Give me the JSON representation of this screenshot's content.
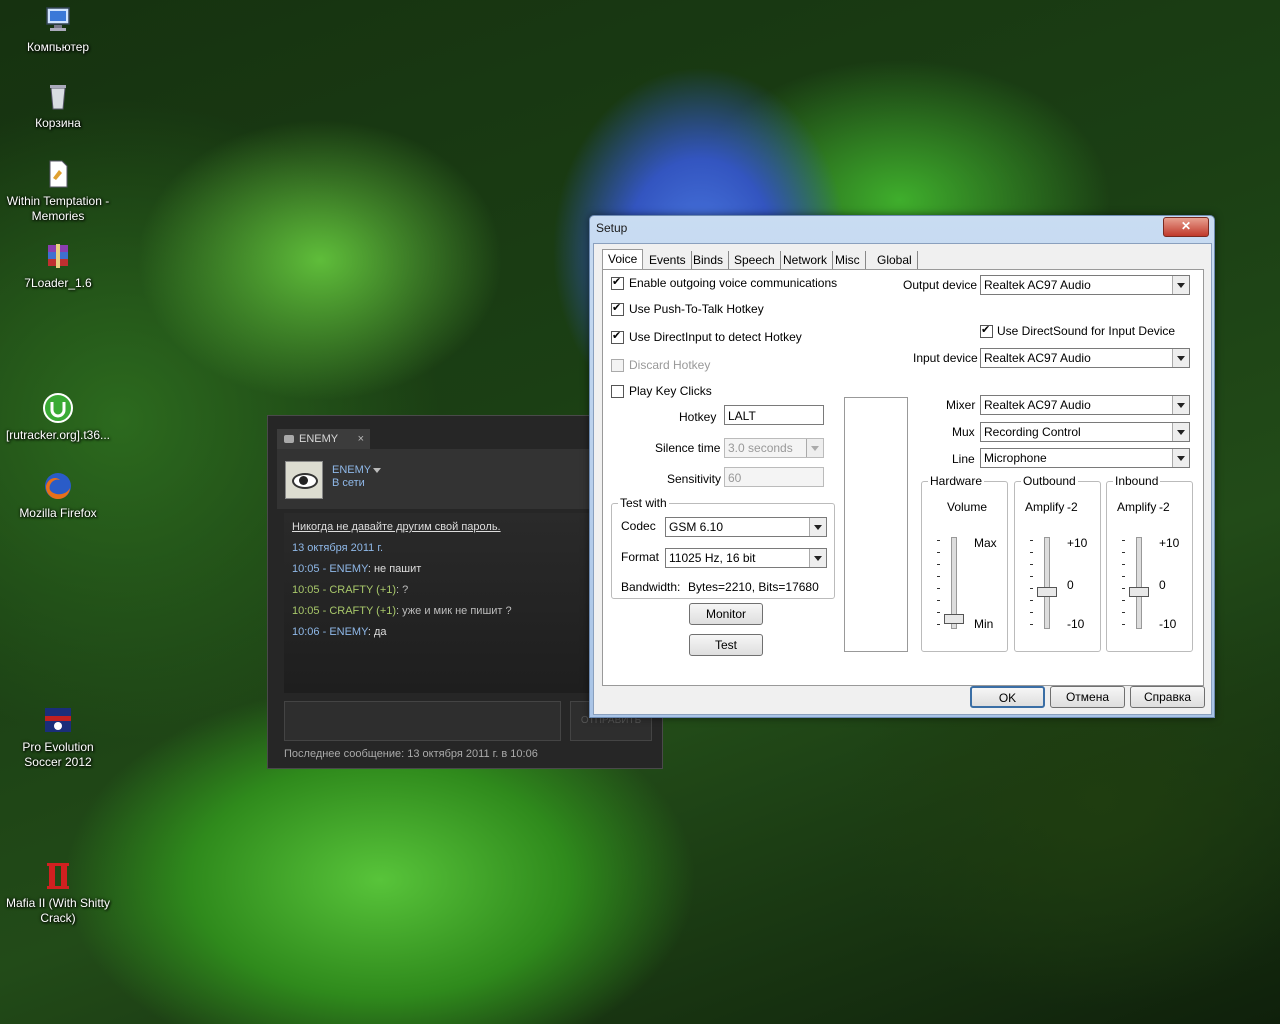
{
  "desktop": {
    "icons": [
      {
        "label": "Компьютер",
        "icon": "computer-icon"
      },
      {
        "label": "Корзина",
        "icon": "recycle-bin-icon"
      },
      {
        "label": "Within Temptation - Memories",
        "icon": "document-icon"
      },
      {
        "label": "7Loader_1.6",
        "icon": "archive-icon"
      },
      {
        "label": "[rutracker.org].t36...",
        "icon": "utorrent-icon"
      },
      {
        "label": "Mozilla Firefox",
        "icon": "firefox-icon"
      },
      {
        "label": "Pro Evolution Soccer 2012",
        "icon": "pes-icon"
      },
      {
        "label": "Mafia II (With Shitty Crack)",
        "icon": "mafia-icon"
      }
    ]
  },
  "chat": {
    "tab_label": "ENEMY",
    "tab_close": "×",
    "username": "ENEMY",
    "status": "В сети",
    "messages": {
      "warning": "Никогда не давайте другим свой пароль.",
      "date": "13 октября 2011 г.",
      "m1_time": "10:05 - ",
      "m1_user": "ENEMY",
      "m1_text": ": не пашит",
      "m2_time": "10:05 - ",
      "m2_user": "CRAFTY (+1)",
      "m2_text": ": ?",
      "m3_time": "10:05 - ",
      "m3_user": "CRAFTY (+1)",
      "m3_text": ": уже и мик не пишит ?",
      "m4_time": "10:06 - ",
      "m4_user": "ENEMY",
      "m4_text": ": да"
    },
    "send_label": "ОТПРАВИТЬ",
    "footer": "Последнее сообщение: 13 октября 2011 г. в 10:06"
  },
  "setup": {
    "title": "Setup",
    "close": "✕",
    "tabs": [
      "Voice",
      "Events",
      "Binds",
      "Speech",
      "Network",
      "Misc",
      "Global"
    ],
    "voice": {
      "enable_outgoing": "Enable outgoing voice communications",
      "use_ptt": "Use Push-To-Talk Hotkey",
      "use_directinput": "Use DirectInput to detect Hotkey",
      "discard_hotkey": "Discard Hotkey",
      "play_key_clicks": "Play Key Clicks",
      "hotkey_label": "Hotkey",
      "hotkey_value": "LALT",
      "silence_label": "Silence time",
      "silence_value": "3.0 seconds",
      "sensitivity_label": "Sensitivity",
      "sensitivity_value": "60",
      "test_with": "Test with",
      "codec_label": "Codec",
      "codec_value": "GSM 6.10",
      "format_label": "Format",
      "format_value": "11025 Hz, 16 bit",
      "bandwidth_label": "Bandwidth:",
      "bandwidth_value": "Bytes=2210, Bits=17680",
      "monitor_btn": "Monitor",
      "test_btn": "Test",
      "output_device_label": "Output device",
      "output_device_value": "Realtek AC97 Audio",
      "use_directsound": "Use DirectSound for Input Device",
      "input_device_label": "Input device",
      "input_device_value": "Realtek AC97 Audio",
      "mixer_label": "Mixer",
      "mixer_value": "Realtek AC97 Audio",
      "mux_label": "Mux",
      "mux_value": "Recording Control",
      "line_label": "Line",
      "line_value": "Microphone",
      "hardware": {
        "title": "Hardware",
        "sub": "Volume",
        "max": "Max",
        "min": "Min",
        "level": 0.1
      },
      "outbound": {
        "title": "Outbound",
        "sub": "Amplify",
        "value": "-2",
        "top": "+10",
        "mid": "0",
        "bot": "-10",
        "level": 0.4
      },
      "inbound": {
        "title": "Inbound",
        "sub": "Amplify",
        "value": "-2",
        "top": "+10",
        "mid": "0",
        "bot": "-10",
        "level": 0.4
      }
    },
    "ok": "OK",
    "cancel": "Отмена",
    "help": "Справка"
  }
}
